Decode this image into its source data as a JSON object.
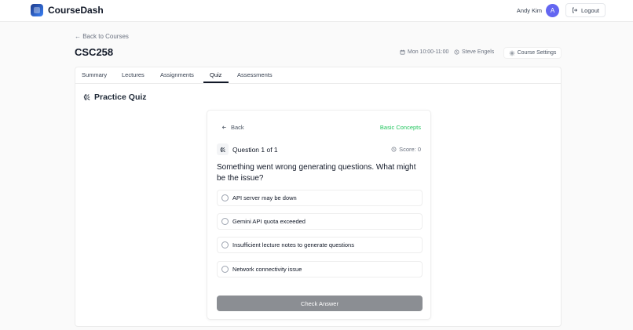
{
  "navbar": {
    "brand": "CourseDash",
    "user_name": "Andy Kim",
    "avatar_initial": "A",
    "logout_label": "Logout"
  },
  "header": {
    "back_label": "← Back to Courses",
    "course_code": "CSC258",
    "schedule": "Mon 10:00-11:00",
    "instructor": "Steve Engels",
    "settings_label": "Course Settings"
  },
  "tabs": [
    {
      "label": "Summary"
    },
    {
      "label": "Lectures"
    },
    {
      "label": "Assignments"
    },
    {
      "label": "Quiz",
      "active": true
    },
    {
      "label": "Assessments"
    }
  ],
  "section": {
    "title": "Practice Quiz"
  },
  "quiz": {
    "back_label": "Back",
    "topic": "Basic Concepts",
    "question_number": "Question 1 of 1",
    "score": "Score: 0",
    "question_text": "Something went wrong generating questions. What might be the issue?",
    "options": [
      {
        "label": "API server may be down"
      },
      {
        "label": "Gemini API quota exceeded"
      },
      {
        "label": "Insufficient lecture notes to generate questions"
      },
      {
        "label": "Network connectivity issue"
      }
    ],
    "submit_label": "Check Answer"
  },
  "colors": {
    "accent_green": "#22c55e",
    "avatar": "#6366f1",
    "submit_disabled": "#8b8e93"
  }
}
